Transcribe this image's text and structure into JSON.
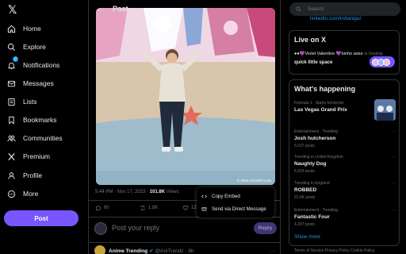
{
  "nav": {
    "logo": "𝕏",
    "items": [
      {
        "label": "Home",
        "icon": "home-icon"
      },
      {
        "label": "Explore",
        "icon": "search-icon"
      },
      {
        "label": "Notifications",
        "icon": "bell-icon",
        "badge": "2"
      },
      {
        "label": "Messages",
        "icon": "mail-icon"
      },
      {
        "label": "Lists",
        "icon": "list-icon"
      },
      {
        "label": "Bookmarks",
        "icon": "bookmark-icon"
      },
      {
        "label": "Communities",
        "icon": "people-icon"
      },
      {
        "label": "Premium",
        "icon": "x-logo-icon"
      },
      {
        "label": "Profile",
        "icon": "person-icon"
      },
      {
        "label": "More",
        "icon": "more-circle-icon"
      }
    ],
    "post_button": "Post"
  },
  "main": {
    "title": "Post",
    "back": "←",
    "copyright": "© 2016 COVER Corp.",
    "timestamp": "5:44 PM · Nov 17, 2023 · ",
    "views_count": "101.8K",
    "views_label": " Views",
    "replies": "60",
    "reposts": "1.8K",
    "likes": "12K",
    "reply_placeholder": "Post your reply",
    "reply_button": "Reply",
    "next_tweet": {
      "name": "Anime Trending",
      "handle": "@AniTrendz · 8h",
      "more": "···"
    }
  },
  "popup": {
    "items": [
      {
        "label": "Copy Embed",
        "icon": "code-icon"
      },
      {
        "label": "Send via Direct Message",
        "icon": "mail-icon"
      }
    ]
  },
  "right": {
    "search_placeholder": "Search",
    "link": "linkedin.com/in/tanigo/",
    "live": {
      "title": "Live on X",
      "host_a": "Violet Valentine",
      "host_b": "binho astur",
      "hosting": "is hosting",
      "space": "quick little space"
    },
    "happening": {
      "title": "What's happening",
      "trends": [
        {
          "meta": "Formula 1 · Starts tomorrow",
          "name": "Las Vegas Grand Prix",
          "posts": "",
          "has_image": true
        },
        {
          "meta": "Entertainment · Trending",
          "name": "Josh hutcherson",
          "posts": "6,037 posts"
        },
        {
          "meta": "Trending in United Kingdom",
          "name": "Naughty Dog",
          "posts": "5,429 posts"
        },
        {
          "meta": "Trending in England",
          "name": "ROBBED",
          "posts": "22.6K posts"
        },
        {
          "meta": "Entertainment · Trending",
          "name": "Fantastic Four",
          "posts": "4,207 posts"
        }
      ],
      "show_more": "Show more"
    },
    "footer": "Terms of Service   Privacy Policy   Cookie Policy"
  },
  "colors": {
    "accent": "#7856ff",
    "link": "#1d9bf0",
    "muted": "#71767b",
    "border": "#2f3336"
  }
}
